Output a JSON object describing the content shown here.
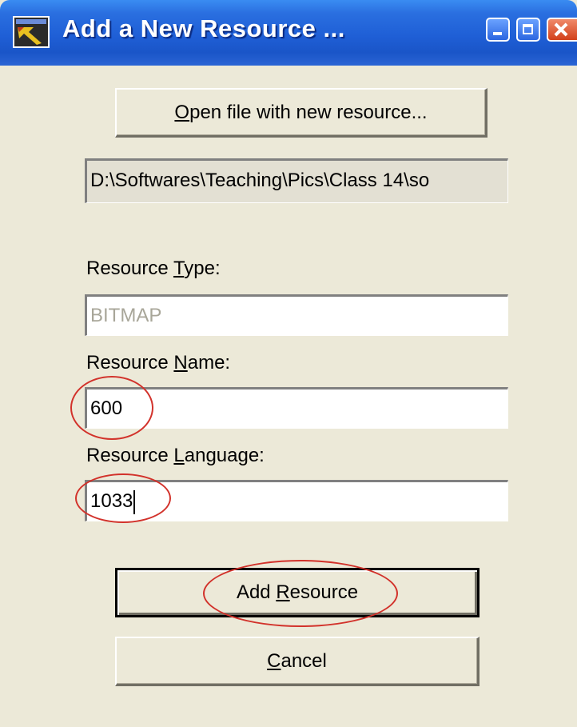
{
  "window": {
    "title": "Add a New Resource ...",
    "title_bar_color": "#1f5fd6"
  },
  "buttons": {
    "open_file_label_mnemonic": "O",
    "open_file_label_rest": "pen file with new resource...",
    "add_resource_label_prefix": "Add ",
    "add_resource_label_mnemonic": "R",
    "add_resource_label_rest": "esource",
    "cancel_label_mnemonic": "C",
    "cancel_label_rest": "ancel"
  },
  "file_path": {
    "value": "D:\\Softwares\\Teaching\\Pics\\Class 14\\so"
  },
  "resource_type": {
    "label_prefix": "Resource ",
    "label_mnemonic": "T",
    "label_rest": "ype:",
    "value": "BITMAP"
  },
  "resource_name": {
    "label_prefix": "Resource ",
    "label_mnemonic": "N",
    "label_rest": "ame:",
    "value": "600"
  },
  "resource_language": {
    "label_prefix": "Resource ",
    "label_mnemonic": "L",
    "label_rest": "anguage:",
    "value": "1033"
  },
  "annotation_color": "#d2322b",
  "icons": [
    "app-icon",
    "minimize-icon",
    "maximize-icon",
    "close-icon"
  ]
}
